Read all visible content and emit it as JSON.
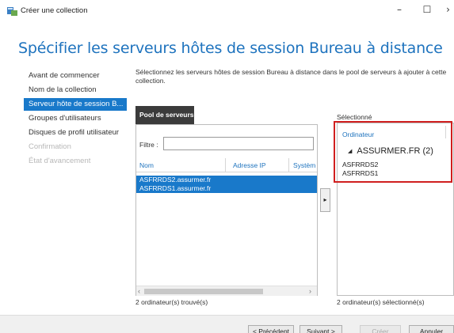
{
  "window": {
    "title": "Créer une collection",
    "minimize_glyph": "–",
    "maximize_glyph": "☐",
    "close_glyph": "›",
    "icon": "server-manager-icon"
  },
  "page_title": "Spécifier les serveurs hôtes de session Bureau à distance",
  "nav": {
    "items": [
      {
        "label": "Avant de commencer",
        "state": "normal"
      },
      {
        "label": "Nom de la collection",
        "state": "normal"
      },
      {
        "label": "Serveur hôte de session B...",
        "state": "active"
      },
      {
        "label": "Groupes d'utilisateurs",
        "state": "normal"
      },
      {
        "label": "Disques de profil utilisateur",
        "state": "normal"
      },
      {
        "label": "Confirmation",
        "state": "disabled"
      },
      {
        "label": "État d'avancement",
        "state": "disabled"
      }
    ]
  },
  "instructions": "Sélectionnez les serveurs hôtes de session Bureau à distance dans le pool de serveurs à ajouter à cette collection.",
  "pool": {
    "tab_label": "Pool de serveurs",
    "filter_label": "Filtre :",
    "filter_value": "",
    "columns": [
      "Nom",
      "Adresse IP",
      "Systèm"
    ],
    "rows": [
      "ASFRRDS2.assurmer.fr",
      "ASFRRDS1.assurmer.fr"
    ],
    "scroll_left": "‹",
    "scroll_right": "›",
    "count_text": "2 ordinateur(s) trouvé(s)"
  },
  "move_button_glyph": "▸",
  "selected": {
    "label": "Sélectionné",
    "column": "Ordinateur",
    "group_glyph": "◢",
    "group": "ASSURMER.FR (2)",
    "items": [
      "ASFRRDS2",
      "ASFRRDS1"
    ],
    "count_text": "2 ordinateur(s) sélectionné(s)"
  },
  "footer": {
    "prev": "< Précédent",
    "next": "Suivant >",
    "create": "Créer",
    "cancel": "Annuler"
  },
  "colors": {
    "accent": "#1979ca",
    "title_blue": "#1e73be",
    "highlight_frame": "#d01f1f"
  }
}
